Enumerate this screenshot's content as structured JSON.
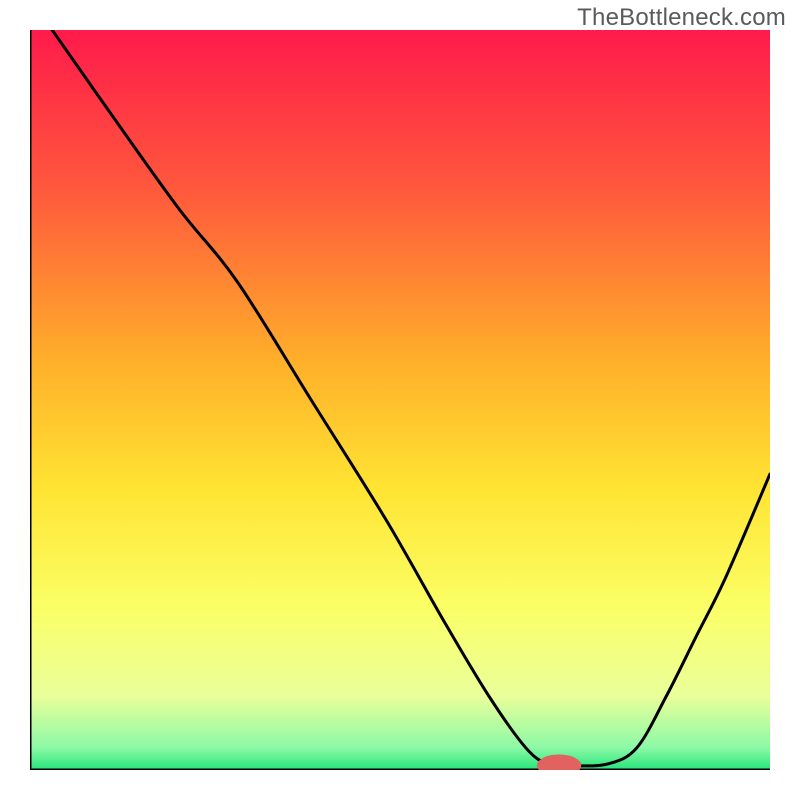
{
  "watermark": "TheBottleneck.com",
  "chart_data": {
    "type": "line",
    "title": "",
    "xlabel": "",
    "ylabel": "",
    "xlim": [
      0,
      100
    ],
    "ylim": [
      0,
      100
    ],
    "background_gradient": {
      "stops": [
        {
          "offset": 0,
          "color": "#ff1a4b"
        },
        {
          "offset": 22,
          "color": "#ff5a3c"
        },
        {
          "offset": 45,
          "color": "#ffb02a"
        },
        {
          "offset": 62,
          "color": "#ffe433"
        },
        {
          "offset": 78,
          "color": "#fbff66"
        },
        {
          "offset": 90,
          "color": "#eaff9a"
        },
        {
          "offset": 97,
          "color": "#8cf9a6"
        },
        {
          "offset": 100,
          "color": "#25e47a"
        }
      ]
    },
    "series": [
      {
        "name": "bottleneck-curve",
        "color": "#000000",
        "x": [
          3,
          10,
          20,
          28,
          38,
          48,
          56,
          62,
          67,
          70,
          73,
          78,
          82,
          86,
          90,
          94,
          100
        ],
        "y": [
          100,
          90,
          76,
          66,
          50,
          34,
          20,
          10,
          3,
          0.8,
          0.6,
          0.8,
          3,
          10,
          18,
          26,
          40
        ]
      }
    ],
    "marker": {
      "name": "optimal-point",
      "x": 71.5,
      "y": 0.6,
      "rx": 3.0,
      "ry": 1.5,
      "color": "#e2625f"
    }
  }
}
